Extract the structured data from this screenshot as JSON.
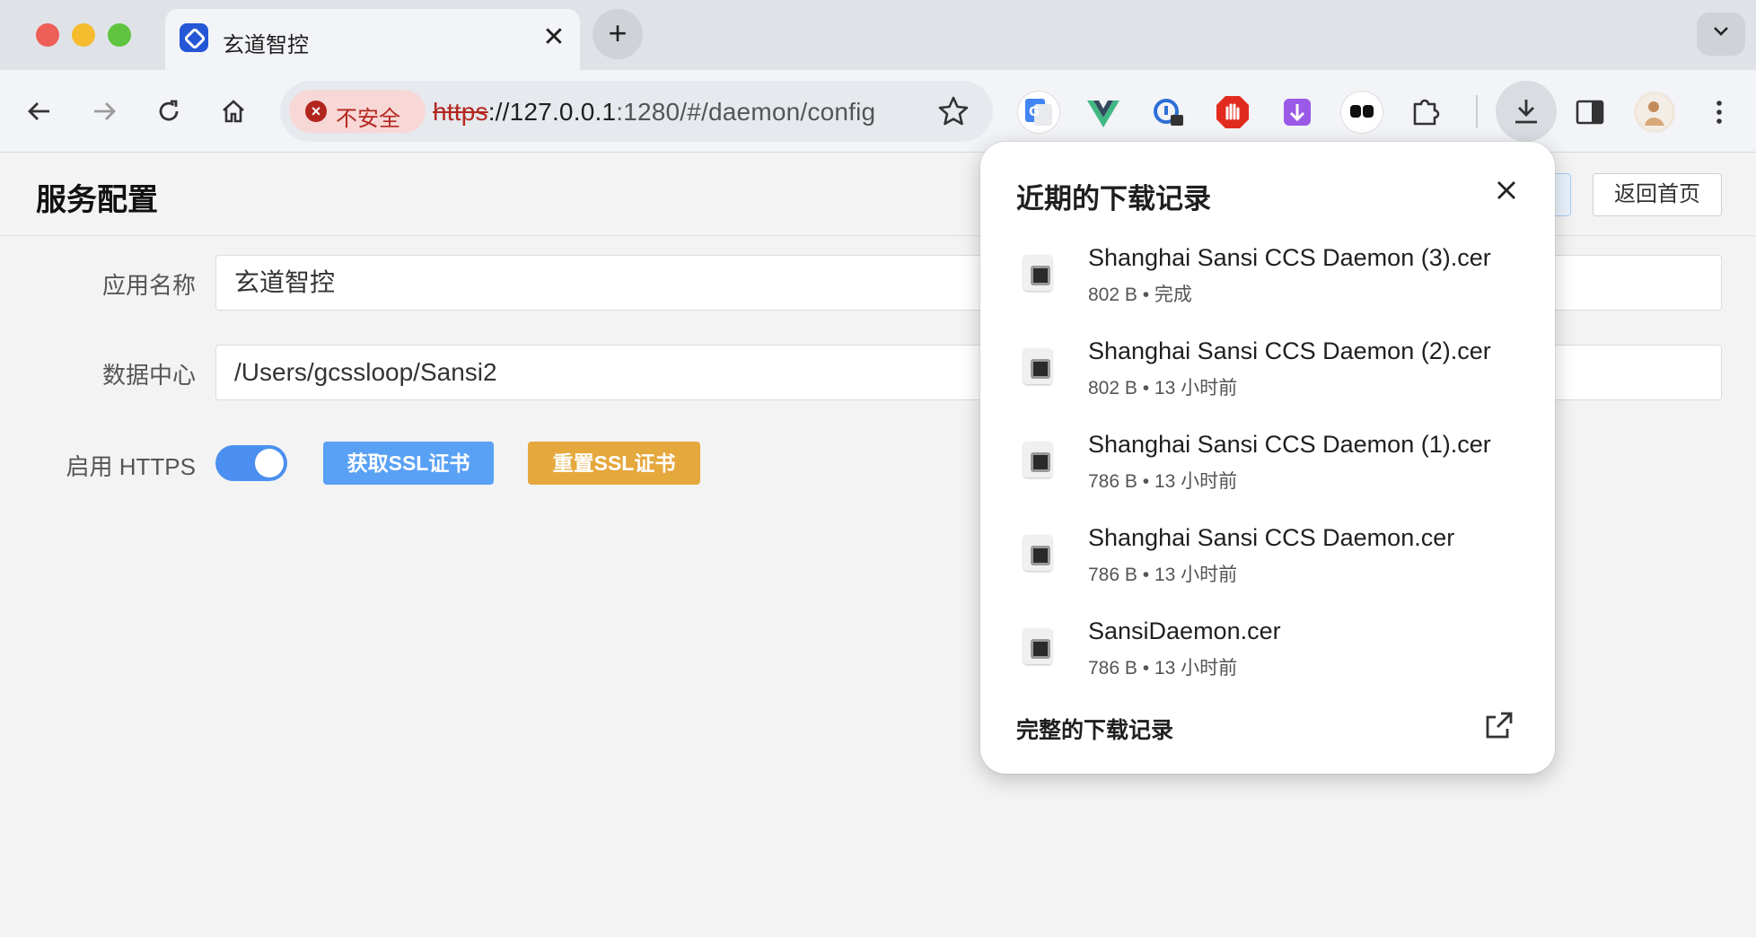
{
  "browser": {
    "tab": {
      "title": "玄道智控"
    },
    "security_chip": "不安全",
    "url": {
      "scheme": "https",
      "host": "://127.0.0.1",
      "rest": ":1280/#/daemon/config"
    }
  },
  "page": {
    "title": "服务配置",
    "home_button": "返回首页",
    "fields": {
      "app_name": {
        "label": "应用名称",
        "value": "玄道智控"
      },
      "data_center": {
        "label": "数据中心",
        "value": "/Users/gcssloop/Sansi2"
      },
      "https": {
        "label": "启用 HTTPS",
        "enabled": true
      }
    },
    "get_ssl_button": "获取SSL证书",
    "reset_ssl_button": "重置SSL证书"
  },
  "downloads": {
    "title": "近期的下载记录",
    "items": [
      {
        "name": "Shanghai Sansi CCS Daemon (3).cer",
        "meta": "802 B • 完成"
      },
      {
        "name": "Shanghai Sansi CCS Daemon (2).cer",
        "meta": "802 B • 13 小时前"
      },
      {
        "name": "Shanghai Sansi CCS Daemon (1).cer",
        "meta": "786 B • 13 小时前"
      },
      {
        "name": "Shanghai Sansi CCS Daemon.cer",
        "meta": "786 B • 13 小时前"
      },
      {
        "name": "SansiDaemon.cer",
        "meta": "786 B • 13 小时前"
      }
    ],
    "footer": "完整的下载记录"
  },
  "icons": {
    "tab_close": "close-icon",
    "new_tab": "plus-icon",
    "back": "arrow-left-icon",
    "forward": "arrow-right-icon",
    "reload": "reload-icon",
    "home": "home-icon",
    "bookmark": "star-icon",
    "download": "download-icon"
  },
  "colors": {
    "accent": "#59a1f4",
    "warning": "#e5a83d",
    "insecure": "#b3261e"
  }
}
